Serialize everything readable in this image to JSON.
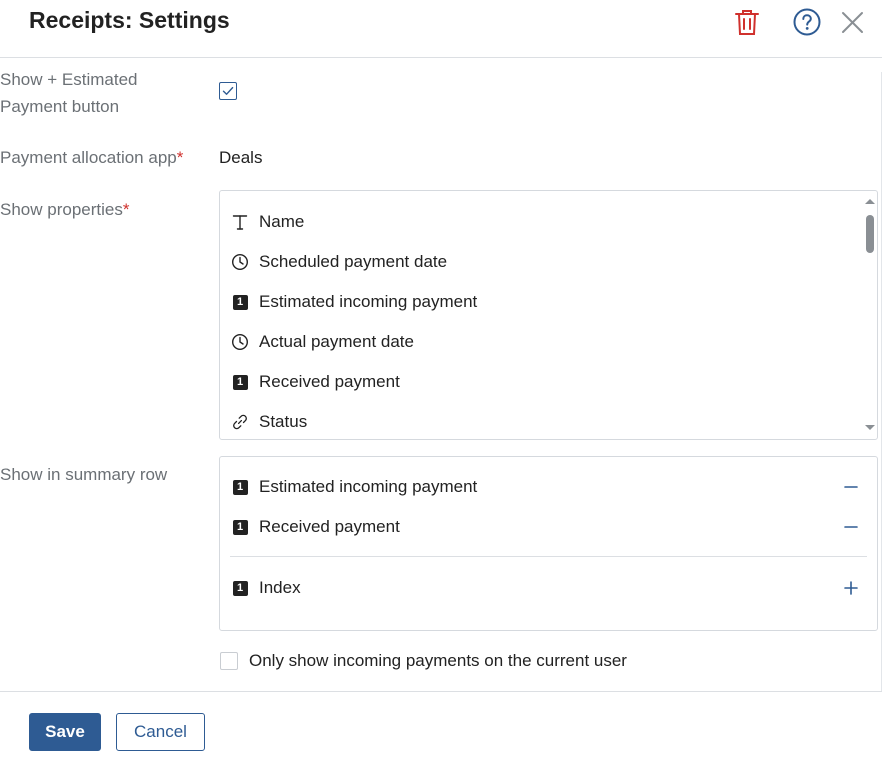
{
  "header": {
    "title": "Receipts: Settings",
    "icons": {
      "delete": "trash-icon",
      "help": "help-icon",
      "close": "close-icon"
    },
    "colors": {
      "delete": "#d0312d",
      "help": "#2e5b93",
      "close": "#8a8f94"
    }
  },
  "form": {
    "estimated_button": {
      "label_line1": "Show + Estimated",
      "label_line2": "Payment button",
      "checked": true
    },
    "allocation": {
      "label": "Payment allocation app",
      "required_mark": "*",
      "value": "Deals"
    },
    "properties": {
      "label": "Show properties",
      "required_mark": "*",
      "items": [
        {
          "icon": "text-icon",
          "label": "Name"
        },
        {
          "icon": "clock-icon",
          "label": "Scheduled payment date"
        },
        {
          "icon": "number-icon",
          "badge": "1",
          "label": "Estimated incoming payment"
        },
        {
          "icon": "clock-icon",
          "label": "Actual payment date"
        },
        {
          "icon": "number-icon",
          "badge": "1",
          "label": "Received payment"
        },
        {
          "icon": "link-icon",
          "label": "Status"
        }
      ]
    },
    "summary": {
      "label": "Show in summary row",
      "selected": [
        {
          "badge": "1",
          "label": "Estimated incoming payment",
          "action": "minus-icon"
        },
        {
          "badge": "1",
          "label": "Received payment",
          "action": "minus-icon"
        }
      ],
      "available": [
        {
          "badge": "1",
          "label": "Index",
          "action": "plus-icon"
        }
      ]
    },
    "current_user_filter": {
      "label": "Only show incoming payments on the current user",
      "checked": false
    }
  },
  "footer": {
    "save_label": "Save",
    "cancel_label": "Cancel"
  },
  "colors": {
    "accent": "#2e5b93",
    "required": "#d0312d",
    "label": "#6b7075"
  }
}
